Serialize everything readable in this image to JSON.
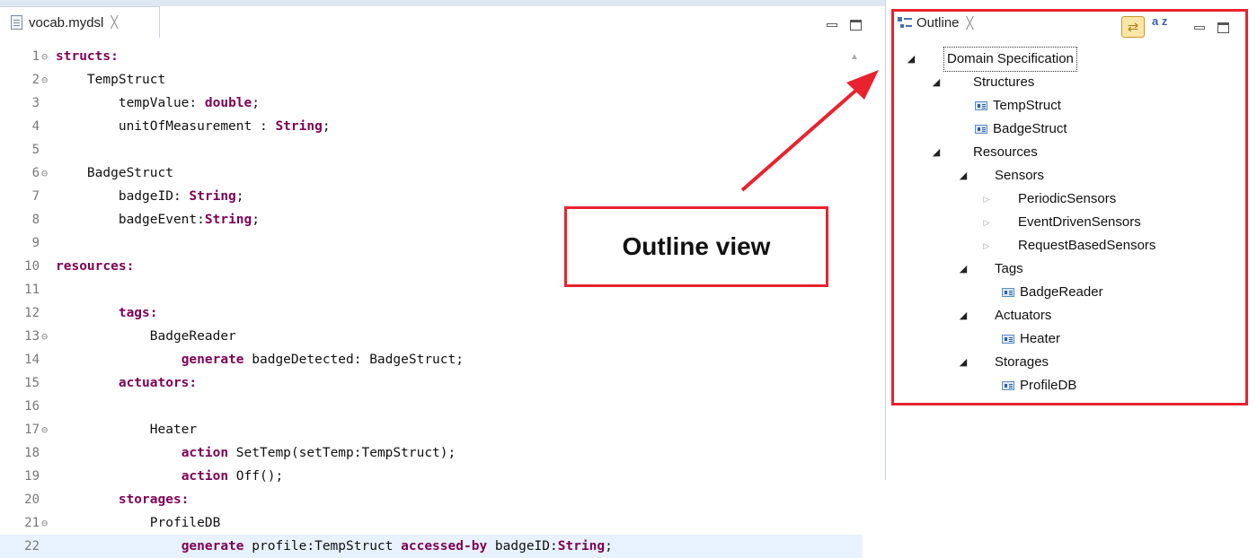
{
  "editor": {
    "tab_label": "vocab.mydsl",
    "tab_close": "╳",
    "lines": [
      {
        "num": "1",
        "fold": "⊖",
        "parts": [
          {
            "t": "structs:",
            "kw": true
          }
        ]
      },
      {
        "num": "2",
        "fold": "⊖",
        "parts": [
          {
            "t": "    TempStruct"
          }
        ]
      },
      {
        "num": "3",
        "fold": "",
        "parts": [
          {
            "t": "        tempValue: "
          },
          {
            "t": "double",
            "kw": true
          },
          {
            "t": ";"
          }
        ]
      },
      {
        "num": "4",
        "fold": "",
        "parts": [
          {
            "t": "        unitOfMeasurement : "
          },
          {
            "t": "String",
            "kw": true
          },
          {
            "t": ";"
          }
        ]
      },
      {
        "num": "5",
        "fold": "",
        "parts": []
      },
      {
        "num": "6",
        "fold": "⊖",
        "parts": [
          {
            "t": "    BadgeStruct"
          }
        ]
      },
      {
        "num": "7",
        "fold": "",
        "parts": [
          {
            "t": "        badgeID: "
          },
          {
            "t": "String",
            "kw": true
          },
          {
            "t": ";"
          }
        ]
      },
      {
        "num": "8",
        "fold": "",
        "parts": [
          {
            "t": "        badgeEvent:"
          },
          {
            "t": "String",
            "kw": true
          },
          {
            "t": ";"
          }
        ]
      },
      {
        "num": "9",
        "fold": "",
        "parts": []
      },
      {
        "num": "10",
        "fold": "",
        "parts": [
          {
            "t": "resources:",
            "kw": true
          }
        ]
      },
      {
        "num": "11",
        "fold": "",
        "parts": []
      },
      {
        "num": "12",
        "fold": "",
        "parts": [
          {
            "t": "        "
          },
          {
            "t": "tags:",
            "kw": true
          }
        ]
      },
      {
        "num": "13",
        "fold": "⊖",
        "parts": [
          {
            "t": "            BadgeReader"
          }
        ]
      },
      {
        "num": "14",
        "fold": "",
        "parts": [
          {
            "t": "                "
          },
          {
            "t": "generate",
            "kw": true
          },
          {
            "t": " badgeDetected: BadgeStruct;"
          }
        ]
      },
      {
        "num": "15",
        "fold": "",
        "parts": [
          {
            "t": "        "
          },
          {
            "t": "actuators:",
            "kw": true
          }
        ]
      },
      {
        "num": "16",
        "fold": "",
        "parts": []
      },
      {
        "num": "17",
        "fold": "⊖",
        "parts": [
          {
            "t": "            Heater"
          }
        ]
      },
      {
        "num": "18",
        "fold": "",
        "parts": [
          {
            "t": "                "
          },
          {
            "t": "action",
            "kw": true
          },
          {
            "t": " SetTemp(setTemp:TempStruct);"
          }
        ]
      },
      {
        "num": "19",
        "fold": "",
        "parts": [
          {
            "t": "                "
          },
          {
            "t": "action",
            "kw": true
          },
          {
            "t": " Off();"
          }
        ]
      },
      {
        "num": "20",
        "fold": "",
        "parts": [
          {
            "t": "        "
          },
          {
            "t": "storages:",
            "kw": true
          }
        ]
      },
      {
        "num": "21",
        "fold": "⊖",
        "parts": [
          {
            "t": "            ProfileDB"
          }
        ]
      },
      {
        "num": "22",
        "fold": "",
        "current": true,
        "parts": [
          {
            "t": "                "
          },
          {
            "t": "generate",
            "kw": true
          },
          {
            "t": " profile:TempStruct "
          },
          {
            "t": "accessed-by",
            "kw": true
          },
          {
            "t": " badgeID:"
          },
          {
            "t": "String",
            "kw": true
          },
          {
            "t": ";"
          }
        ]
      }
    ]
  },
  "outline": {
    "tab_label": "Outline",
    "tab_close": "╳",
    "link_icon": "⇄",
    "sort_icon_text": "a z",
    "tree": [
      {
        "label": "Domain Specification",
        "level": 0,
        "twisty": "expanded",
        "icon": false,
        "selected": true
      },
      {
        "label": "Structures",
        "level": 1,
        "twisty": "expanded",
        "icon": false
      },
      {
        "label": "TempStruct",
        "level": 2,
        "twisty": "none",
        "icon": true
      },
      {
        "label": "BadgeStruct",
        "level": 2,
        "twisty": "none",
        "icon": true
      },
      {
        "label": "Resources",
        "level": 1,
        "twisty": "expanded",
        "icon": false
      },
      {
        "label": "Sensors",
        "level": 2,
        "twisty": "expanded",
        "icon": false
      },
      {
        "label": "PeriodicSensors",
        "level": 3,
        "twisty": "collapsed",
        "icon": false
      },
      {
        "label": "EventDrivenSensors",
        "level": 3,
        "twisty": "collapsed",
        "icon": false
      },
      {
        "label": "RequestBasedSensors",
        "level": 3,
        "twisty": "collapsed",
        "icon": false
      },
      {
        "label": "Tags",
        "level": 2,
        "twisty": "expanded",
        "icon": false
      },
      {
        "label": "BadgeReader",
        "level": 3,
        "twisty": "none",
        "icon": true
      },
      {
        "label": "Actuators",
        "level": 2,
        "twisty": "expanded",
        "icon": false
      },
      {
        "label": "Heater",
        "level": 3,
        "twisty": "none",
        "icon": true
      },
      {
        "label": "Storages",
        "level": 2,
        "twisty": "expanded",
        "icon": false
      },
      {
        "label": "ProfileDB",
        "level": 3,
        "twisty": "none",
        "icon": true
      }
    ]
  },
  "callout": {
    "label": "Outline view"
  },
  "colors": {
    "keyword": "#7f0055",
    "highlight_box": "#e8232f",
    "current_line": "#e8f2fe"
  }
}
